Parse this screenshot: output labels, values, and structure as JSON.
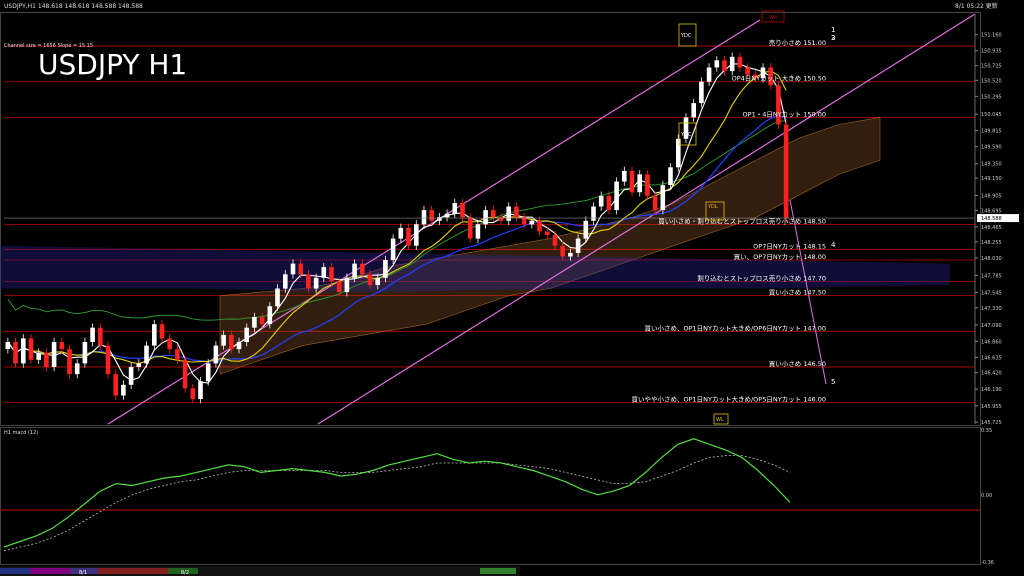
{
  "header": {
    "symbol_line": "USDJPY,H1  148.618 148.618 148.588 148.588",
    "datetime": "8/1 05:22 更新",
    "big_title": "USDJPY H1",
    "channel_info_1": "Channel size = 1656 Slope = 15.15"
  },
  "macd_label": "H1  macd (12)",
  "colors": {
    "background": "#000000",
    "bull_candle": "#ffffff",
    "bear_candle": "#ff2020",
    "ma_white": "#ffffff",
    "ma_yellow": "#e8d000",
    "ma_blue": "#2040ff",
    "chikou_green": "#2ca02c",
    "channel_violet": "#e070e0",
    "level_line": "#c00000",
    "macd_line": "#55dd44",
    "macd_signal": "#c0c0c0"
  },
  "annotations": [
    {
      "text": "売り小さめ 151.00",
      "price": 151.0
    },
    {
      "text": "OP4日NYカット 大きめ 150.50",
      "price": 150.5
    },
    {
      "text": "OP1・4日NYカット 150.00",
      "price": 150.0
    },
    {
      "text": "買い小さめ・割り込むとストップロス売り小さめ 148.50",
      "price": 148.5
    },
    {
      "text": "OP7日NYカット 148.15",
      "price": 148.15
    },
    {
      "text": "買い、OP7日NYカット 148.00",
      "price": 148.0
    },
    {
      "text": "割り込むとストップロス売り小さめ 147.70",
      "price": 147.7
    },
    {
      "text": "買い小さめ 147.50",
      "price": 147.5
    },
    {
      "text": "買い小さめ、OP1日NYカット大きめ/OP6日NYカット 147.00",
      "price": 147.0
    },
    {
      "text": "買い小さめ 146.50",
      "price": 146.5
    },
    {
      "text": "買いやや小さめ、OP1日NYカット大きめ/OP5日NYカット 146.00",
      "price": 146.0
    }
  ],
  "labels": {
    "ydc1": "YDC",
    "ydc2": "YDC",
    "ydl": "YDL",
    "wh": "WH",
    "wl": "WL",
    "lvl1": "1",
    "lvl2": "2",
    "lvl3": "3",
    "lvl4": "4",
    "lvl5": "5",
    "tab1": "8/1",
    "tab2": "8/2"
  },
  "chart_data": {
    "type": "candlestick",
    "title": "USDJPY H1",
    "ylim": [
      145.7,
      151.45
    ],
    "y_ticks": [
      151.16,
      150.935,
      150.725,
      150.52,
      150.295,
      150.045,
      149.815,
      149.59,
      149.35,
      149.15,
      148.905,
      148.695,
      148.465,
      148.255,
      148.03,
      147.785,
      147.545,
      147.33,
      147.09,
      146.86,
      146.635,
      146.42,
      146.19,
      145.955,
      145.725
    ],
    "current_price": 148.588,
    "closes": [
      146.85,
      146.55,
      146.9,
      146.6,
      146.7,
      146.5,
      146.85,
      146.75,
      146.4,
      146.55,
      146.85,
      147.05,
      146.8,
      146.4,
      146.1,
      146.25,
      146.5,
      146.55,
      146.8,
      147.1,
      146.9,
      146.75,
      146.6,
      146.2,
      146.05,
      146.3,
      146.55,
      146.8,
      146.95,
      146.75,
      146.85,
      147.05,
      147.2,
      147.1,
      147.35,
      147.6,
      147.8,
      147.95,
      147.8,
      147.6,
      147.75,
      147.9,
      147.7,
      147.55,
      147.75,
      147.95,
      147.8,
      147.65,
      147.75,
      148.0,
      148.3,
      148.45,
      148.2,
      148.5,
      148.7,
      148.55,
      148.6,
      148.65,
      148.8,
      148.6,
      148.3,
      148.5,
      148.7,
      148.6,
      148.55,
      148.75,
      148.6,
      148.5,
      148.55,
      148.4,
      148.35,
      148.2,
      148.05,
      148.1,
      148.3,
      148.55,
      148.75,
      148.9,
      148.7,
      149.1,
      149.25,
      148.95,
      149.2,
      148.9,
      148.7,
      149.05,
      149.3,
      149.7,
      150.0,
      150.2,
      150.5,
      150.7,
      150.8,
      150.65,
      150.85,
      150.7,
      150.6,
      150.55,
      150.7,
      150.45,
      149.9,
      148.588
    ],
    "macd": {
      "ylim": [
        -0.36,
        0.347
      ],
      "main": [
        -0.28,
        -0.25,
        -0.22,
        -0.18,
        -0.12,
        -0.05,
        0.02,
        0.06,
        0.05,
        0.07,
        0.09,
        0.1,
        0.12,
        0.14,
        0.16,
        0.15,
        0.12,
        0.13,
        0.14,
        0.13,
        0.12,
        0.1,
        0.11,
        0.13,
        0.16,
        0.18,
        0.2,
        0.22,
        0.19,
        0.17,
        0.18,
        0.17,
        0.15,
        0.13,
        0.1,
        0.07,
        0.03,
        0.0,
        0.02,
        0.05,
        0.12,
        0.2,
        0.27,
        0.3,
        0.27,
        0.24,
        0.2,
        0.13,
        0.05,
        -0.04
      ],
      "signal": [
        -0.3,
        -0.28,
        -0.26,
        -0.23,
        -0.19,
        -0.14,
        -0.09,
        -0.04,
        0.0,
        0.03,
        0.05,
        0.07,
        0.08,
        0.1,
        0.12,
        0.13,
        0.13,
        0.13,
        0.13,
        0.13,
        0.13,
        0.12,
        0.12,
        0.12,
        0.13,
        0.14,
        0.15,
        0.17,
        0.17,
        0.17,
        0.17,
        0.17,
        0.16,
        0.15,
        0.14,
        0.12,
        0.1,
        0.08,
        0.06,
        0.06,
        0.07,
        0.1,
        0.13,
        0.17,
        0.2,
        0.21,
        0.21,
        0.19,
        0.16,
        0.12
      ]
    }
  }
}
